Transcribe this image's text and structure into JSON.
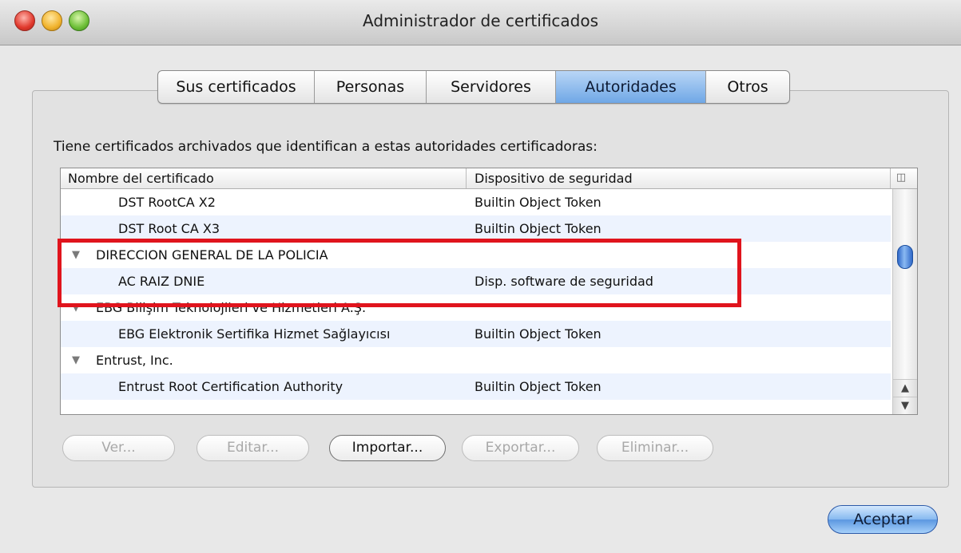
{
  "window": {
    "title": "Administrador de certificados"
  },
  "tabs": [
    {
      "label": "Sus certificados",
      "active": false
    },
    {
      "label": "Personas",
      "active": false
    },
    {
      "label": "Servidores",
      "active": false
    },
    {
      "label": "Autoridades",
      "active": true
    },
    {
      "label": "Otros",
      "active": false
    }
  ],
  "description": "Tiene certificados archivados que identifican a estas autoridades certificadoras:",
  "table": {
    "columns": [
      "Nombre del certificado",
      "Dispositivo de seguridad"
    ],
    "column_picker_icon": "column-picker-icon",
    "rows": [
      {
        "name": "DST RootCA X2",
        "device": "Builtin Object Token",
        "level": "child"
      },
      {
        "name": "DST Root CA X3",
        "device": "Builtin Object Token",
        "level": "child"
      },
      {
        "name": "DIRECCION GENERAL DE LA POLICIA",
        "device": "",
        "level": "parent"
      },
      {
        "name": "AC RAIZ DNIE",
        "device": "Disp. software de seguridad",
        "level": "child"
      },
      {
        "name": "EBG Bilişim Teknolojileri ve Hizmetleri A.Ş.",
        "device": "",
        "level": "parent"
      },
      {
        "name": "EBG Elektronik Sertifika Hizmet Sağlayıcısı",
        "device": "Builtin Object Token",
        "level": "child"
      },
      {
        "name": "Entrust, Inc.",
        "device": "",
        "level": "parent"
      },
      {
        "name": "Entrust Root Certification Authority",
        "device": "Builtin Object Token",
        "level": "child"
      }
    ]
  },
  "buttons": {
    "ver": "Ver...",
    "editar": "Editar...",
    "importar": "Importar...",
    "exportar": "Exportar...",
    "eliminar": "Eliminar..."
  },
  "accept_label": "Aceptar",
  "colors": {
    "highlight": "#e0141d",
    "accent": "#6fa7e6"
  }
}
